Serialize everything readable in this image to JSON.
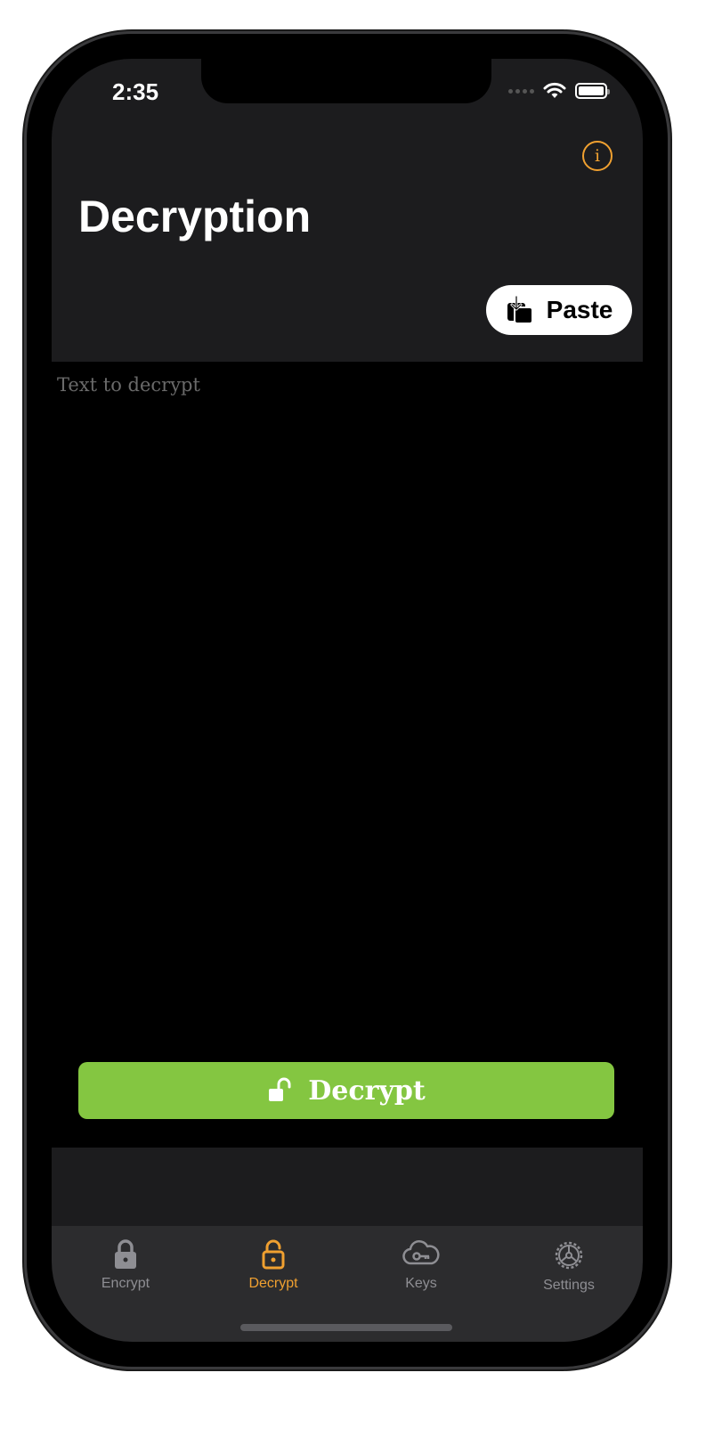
{
  "status_bar": {
    "time": "2:35"
  },
  "header": {
    "title": "Decryption",
    "paste_label": "Paste",
    "info_icon": "info-circle-icon"
  },
  "editor": {
    "placeholder": "Text to decrypt",
    "value": ""
  },
  "action": {
    "decrypt_label": "Decrypt",
    "icon": "unlock-icon"
  },
  "tabbar": {
    "items": [
      {
        "label": "Encrypt",
        "icon": "lock-icon",
        "active": false
      },
      {
        "label": "Decrypt",
        "icon": "unlock-icon",
        "active": true
      },
      {
        "label": "Keys",
        "icon": "cloud-key-icon",
        "active": false
      },
      {
        "label": "Settings",
        "icon": "gear-icon",
        "active": false
      }
    ]
  },
  "colors": {
    "accent": "#f0a030",
    "decrypt_button": "#84c641",
    "header_bg": "#1c1c1e",
    "tabbar_bg": "#2c2c2e",
    "inactive_tab": "#8e8e93"
  }
}
